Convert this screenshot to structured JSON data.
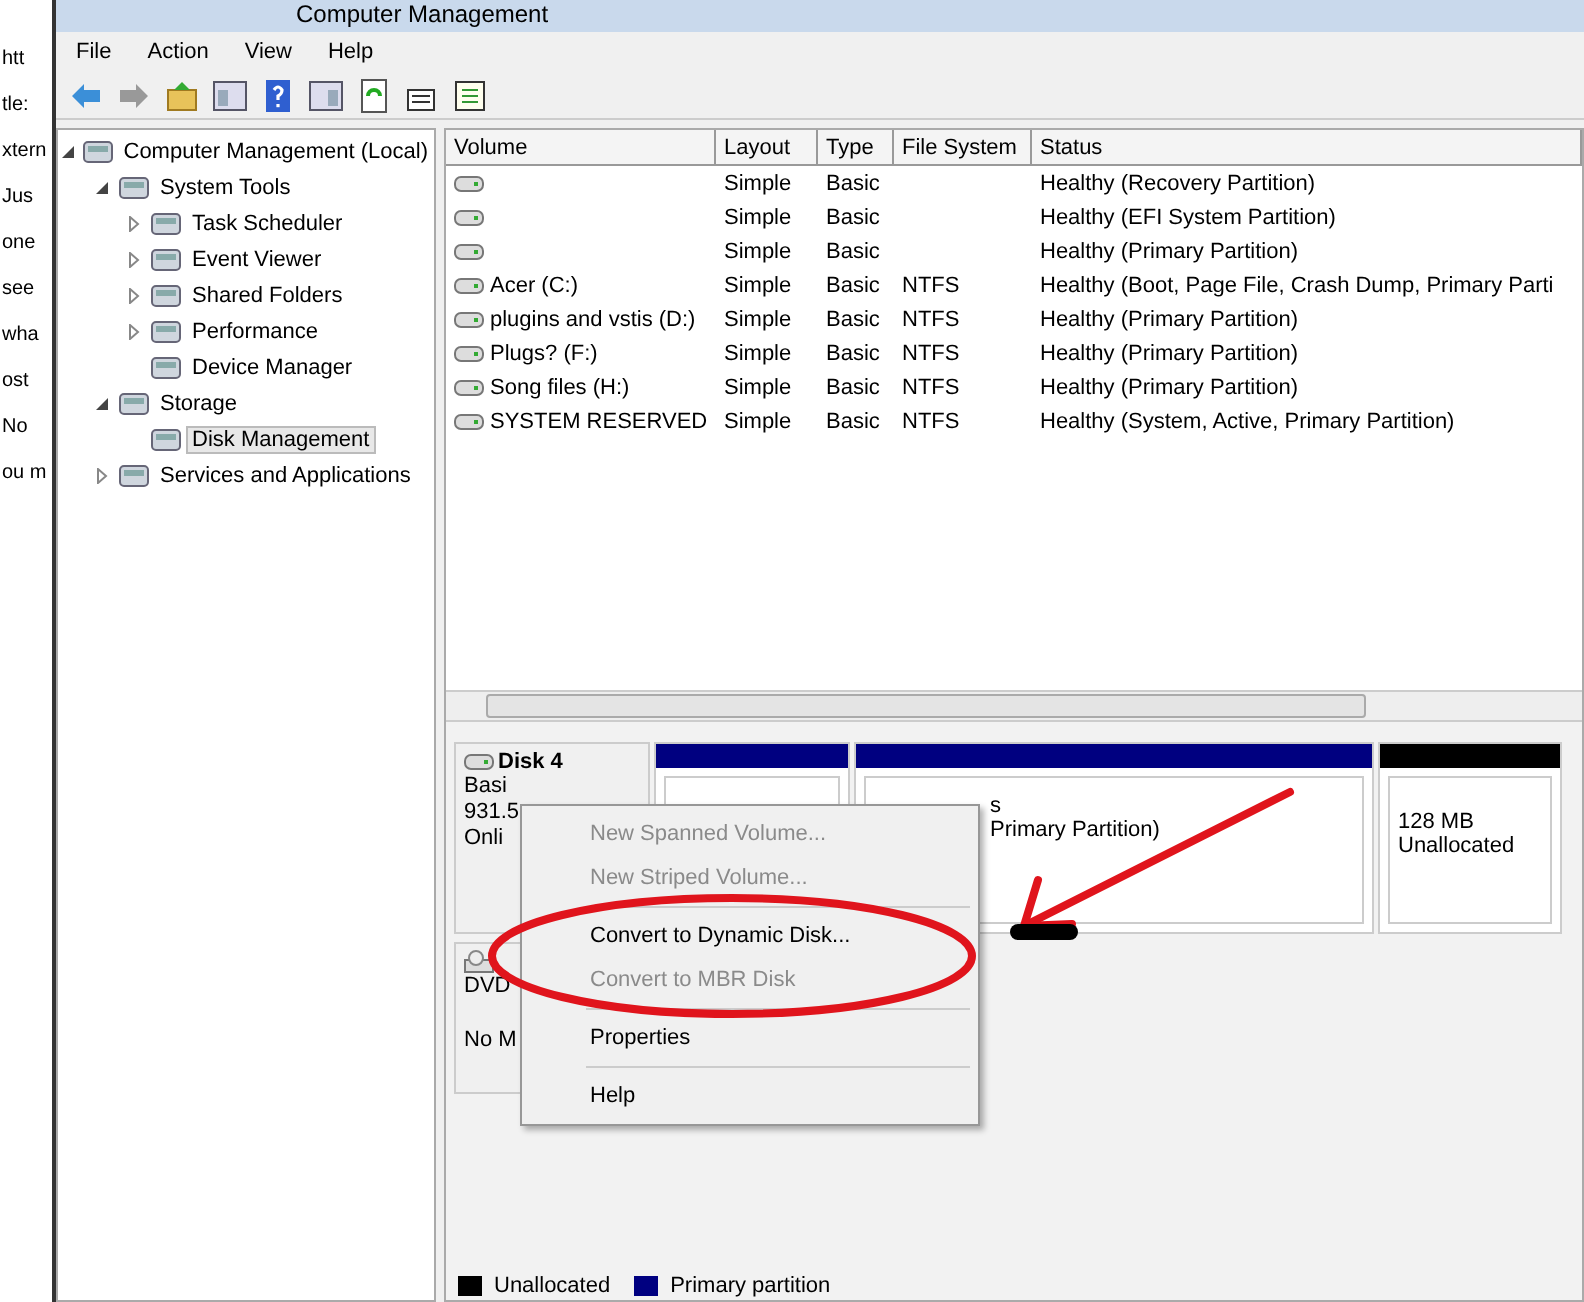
{
  "background_page": {
    "fragments": [
      "htt",
      "tle:",
      "xtern",
      "Jus",
      "one",
      "see",
      "wha",
      "ost",
      "No",
      "ou m"
    ]
  },
  "window": {
    "title": "Computer Management"
  },
  "menu_bar": [
    "File",
    "Action",
    "View",
    "Help"
  ],
  "tree": [
    {
      "label": "Computer Management (Local)",
      "selected": false,
      "expanded": true,
      "children": [
        {
          "label": "System Tools",
          "selected": false,
          "expanded": true,
          "children": [
            {
              "label": "Task Scheduler",
              "selected": false,
              "expanded": false
            },
            {
              "label": "Event Viewer",
              "selected": false,
              "expanded": false
            },
            {
              "label": "Shared Folders",
              "selected": false,
              "expanded": false
            },
            {
              "label": "Performance",
              "selected": false,
              "expanded": false
            },
            {
              "label": "Device Manager",
              "selected": false
            }
          ]
        },
        {
          "label": "Storage",
          "selected": false,
          "expanded": true,
          "children": [
            {
              "label": "Disk Management",
              "selected": true
            }
          ]
        },
        {
          "label": "Services and Applications",
          "selected": false,
          "expanded": false
        }
      ]
    }
  ],
  "volumes": {
    "columns": [
      "Volume",
      "Layout",
      "Type",
      "File System",
      "Status"
    ],
    "rows": [
      [
        "",
        "Simple",
        "Basic",
        "",
        "Healthy (Recovery Partition)"
      ],
      [
        "",
        "Simple",
        "Basic",
        "",
        "Healthy (EFI System Partition)"
      ],
      [
        "",
        "Simple",
        "Basic",
        "",
        "Healthy (Primary Partition)"
      ],
      [
        "Acer (C:)",
        "Simple",
        "Basic",
        "NTFS",
        "Healthy (Boot, Page File, Crash Dump, Primary Parti"
      ],
      [
        "plugins and vstis (D:)",
        "Simple",
        "Basic",
        "NTFS",
        "Healthy (Primary Partition)"
      ],
      [
        "Plugs? (F:)",
        "Simple",
        "Basic",
        "NTFS",
        "Healthy (Primary Partition)"
      ],
      [
        "Song files (H:)",
        "Simple",
        "Basic",
        "NTFS",
        "Healthy (Primary Partition)"
      ],
      [
        "SYSTEM RESERVED",
        "Simple",
        "Basic",
        "NTFS",
        "Healthy (System, Active, Primary Partition)"
      ]
    ]
  },
  "disks": [
    {
      "kind": "disk",
      "name": "Disk 4",
      "lines": [
        "Basi",
        "931.5",
        "Onli"
      ],
      "partitions": [
        {
          "color": "#000080"
        },
        {
          "color": "#000080",
          "lines": [
            "s",
            "Primary Partition)"
          ]
        },
        {
          "color": "#000000",
          "lines": [
            "128 MB",
            "Unallocated"
          ]
        }
      ]
    },
    {
      "kind": "cdrom",
      "lines": [
        "DVD",
        "No M"
      ]
    }
  ],
  "context_menu": [
    {
      "kind": "item",
      "label": "New Spanned Volume...",
      "disabled": true
    },
    {
      "kind": "item",
      "label": "New Striped Volume...",
      "disabled": true
    },
    {
      "kind": "separator"
    },
    {
      "kind": "item",
      "label": "Convert to Dynamic Disk...",
      "disabled": false
    },
    {
      "kind": "item",
      "label": "Convert to MBR Disk",
      "disabled": true
    },
    {
      "kind": "separator"
    },
    {
      "kind": "item",
      "label": "Properties",
      "disabled": false
    },
    {
      "kind": "separator"
    },
    {
      "kind": "item",
      "label": "Help",
      "disabled": false
    }
  ],
  "legend": [
    {
      "label": "Unallocated",
      "color": "#000000"
    },
    {
      "label": "Primary partition",
      "color": "#000080"
    }
  ]
}
